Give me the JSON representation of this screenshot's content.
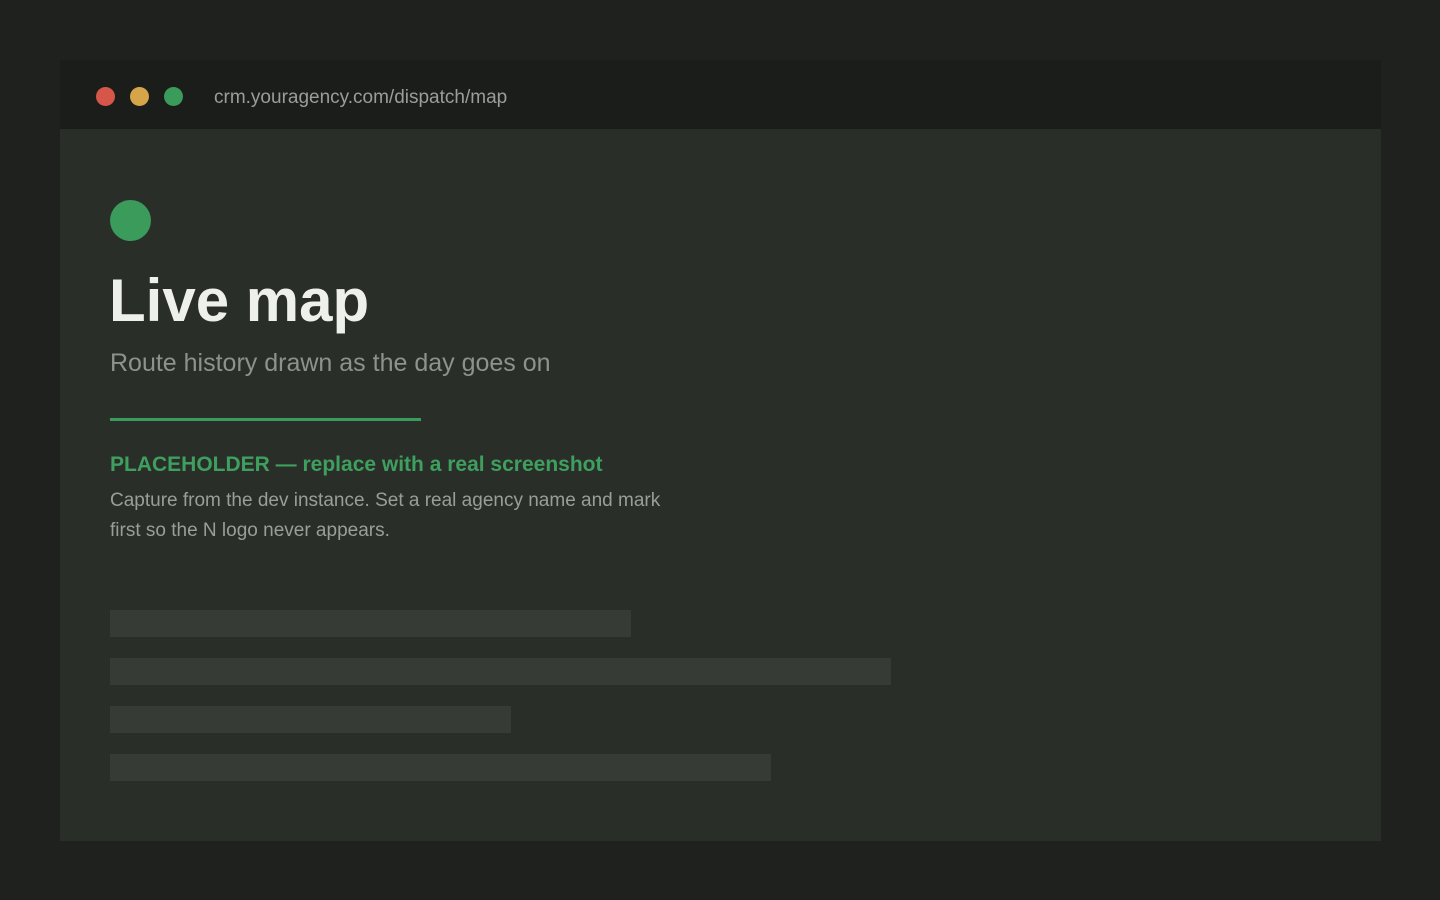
{
  "window": {
    "url": "crm.youragency.com/dispatch/map",
    "controls": {
      "close_color": "#d6564a",
      "minimize_color": "#d6a449",
      "maximize_color": "#3a9b5b"
    }
  },
  "page": {
    "logo": "status-dot-icon",
    "title": "Live map",
    "subtitle": "Route history drawn as the day goes on",
    "accent_color": "#3a9b5b",
    "placeholder": {
      "heading": "PLACEHOLDER — replace with a real screenshot",
      "body": "Capture from the dev instance. Set a real agency name and mark first so the N logo never appears."
    }
  }
}
